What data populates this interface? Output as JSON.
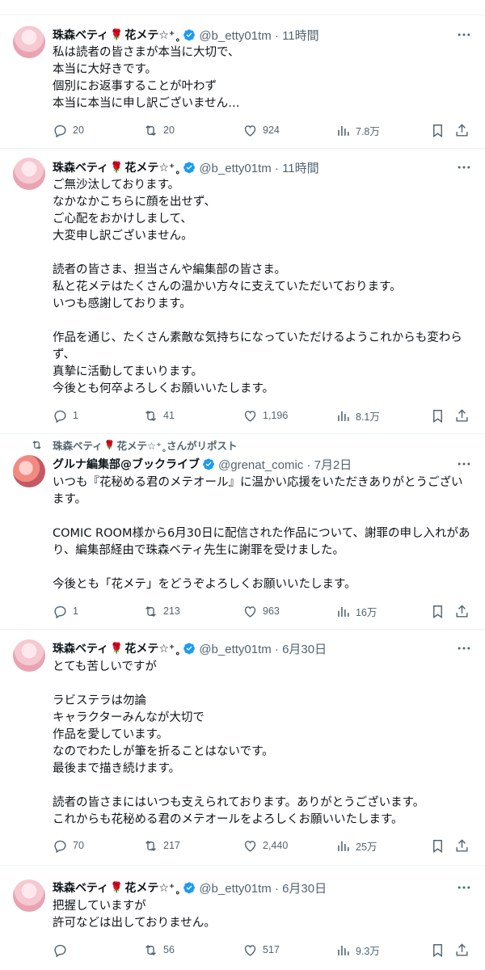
{
  "accent": "#1d9bf0",
  "tweets": [
    {
      "display_name": "珠森ベティ",
      "name_suffix": "花メテ☆⁺˳",
      "handle": "@b_etty01tm · 11時間",
      "text": "私は読者の皆さまが本当に大切で、\n本当に大好きです。\n個別にお返事することが叶わず\n本当に本当に申し訳ございません…",
      "replies": "20",
      "retweets": "20",
      "likes": "924",
      "views": "7.8万"
    },
    {
      "display_name": "珠森ベティ",
      "name_suffix": "花メテ☆⁺˳",
      "handle": "@b_etty01tm · 11時間",
      "text": "ご無沙汰しております。\nなかなかこちらに顔を出せず、\nご心配をおかけしまして、\n大変申し訳ございません。\n\n読者の皆さま、担当さんや編集部の皆さま。\n私と花メテはたくさんの温かい方々に支えていただいております。\nいつも感謝しております。\n\n作品を通じ、たくさん素敵な気持ちになっていただけるようこれからも変わらず、\n真摯に活動してまいります。\n今後とも何卒よろしくお願いいたします。",
      "replies": "1",
      "retweets": "41",
      "likes": "1,196",
      "views": "8.1万"
    },
    {
      "repost_by": "珠森ベティ",
      "repost_suffix": "花メテ☆⁺˳さんがリポスト",
      "display_name": "グルナ編集部@ブックライブ",
      "name_suffix": "",
      "handle": "@grenat_comic · 7月2日",
      "text": "いつも『花秘める君のメテオール』に温かい応援をいただきありがとうございます。\n\nCOMIC ROOM様から6月30日に配信された作品について、謝罪の申し入れがあり、編集部経由で珠森ベティ先生に謝罪を受けました。\n\n今後とも「花メテ」をどうぞよろしくお願いいたします。",
      "replies": "1",
      "retweets": "213",
      "likes": "963",
      "views": "16万"
    },
    {
      "display_name": "珠森ベティ",
      "name_suffix": "花メテ☆⁺˳",
      "handle": "@b_etty01tm · 6月30日",
      "text": "とても苦しいですが\n\nラビステラは勿論\nキャラクターみんなが大切で\n作品を愛しています。\nなのでわたしが筆を折ることはないです。\n最後まで描き続けます。\n\n読者の皆さまにはいつも支えられております。ありがとうございます。\nこれからも花秘める君のメテオールをよろしくお願いいたします。",
      "replies": "70",
      "retweets": "217",
      "likes": "2,440",
      "views": "25万"
    },
    {
      "display_name": "珠森ベティ",
      "name_suffix": "花メテ☆⁺˳",
      "handle": "@b_etty01tm · 6月30日",
      "text": "把握していますが\n許可などは出しておりません。",
      "replies": "",
      "retweets": "56",
      "likes": "517",
      "views": "9.3万"
    }
  ]
}
